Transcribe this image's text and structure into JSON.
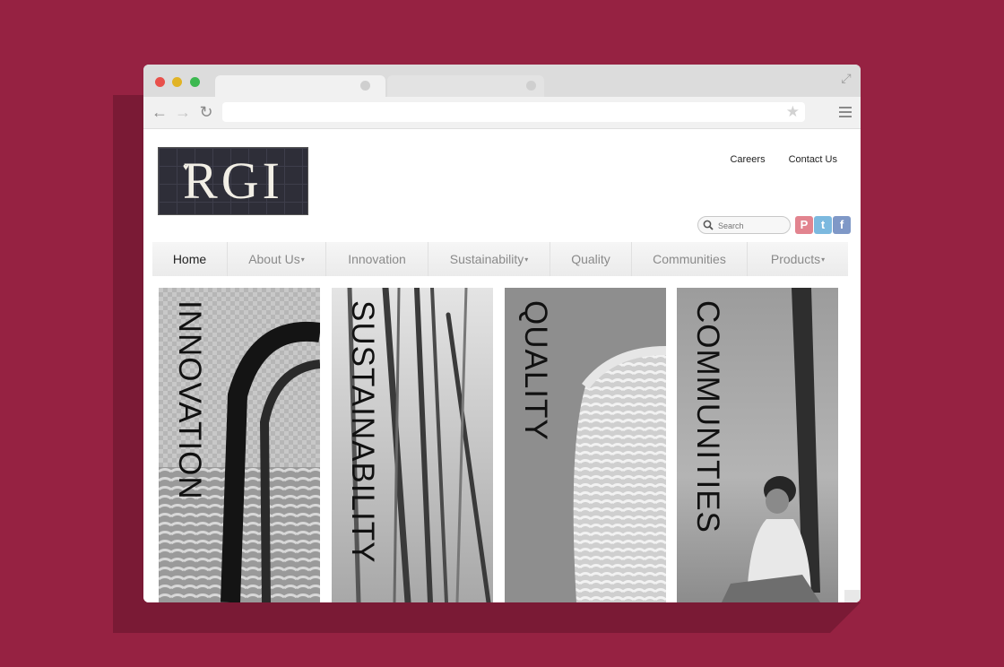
{
  "browser": {
    "icons": {
      "back": "back-arrow-icon",
      "forward": "forward-arrow-icon",
      "reload": "reload-icon",
      "star": "star-icon",
      "menu": "menu-icon",
      "expand": "expand-icon"
    },
    "address_value": ""
  },
  "site": {
    "logo_text": "RGI",
    "top_links": [
      "Careers",
      "Contact Us"
    ],
    "search_placeholder": "Search",
    "social": [
      {
        "name": "pinterest-icon",
        "glyph": "P",
        "color": "#e2848f"
      },
      {
        "name": "twitter-icon",
        "glyph": "t",
        "color": "#7cb9df"
      },
      {
        "name": "facebook-icon",
        "glyph": "f",
        "color": "#7f98c7"
      }
    ],
    "nav": [
      {
        "label": "Home",
        "dropdown": false
      },
      {
        "label": "About Us",
        "dropdown": true
      },
      {
        "label": "Innovation",
        "dropdown": false
      },
      {
        "label": "Sustainability",
        "dropdown": true
      },
      {
        "label": "Quality",
        "dropdown": false
      },
      {
        "label": "Communities",
        "dropdown": false
      },
      {
        "label": "Products",
        "dropdown": true
      }
    ],
    "panels": [
      {
        "label": "INNOVATION"
      },
      {
        "label": "SUSTAINABILITY"
      },
      {
        "label": "QUALITY"
      },
      {
        "label": "COMMUNITIES"
      }
    ]
  },
  "colors": {
    "background": "#962242",
    "shadow": "#7a1a35",
    "nav_active": "#222222",
    "nav_text": "#8a8a8a"
  }
}
